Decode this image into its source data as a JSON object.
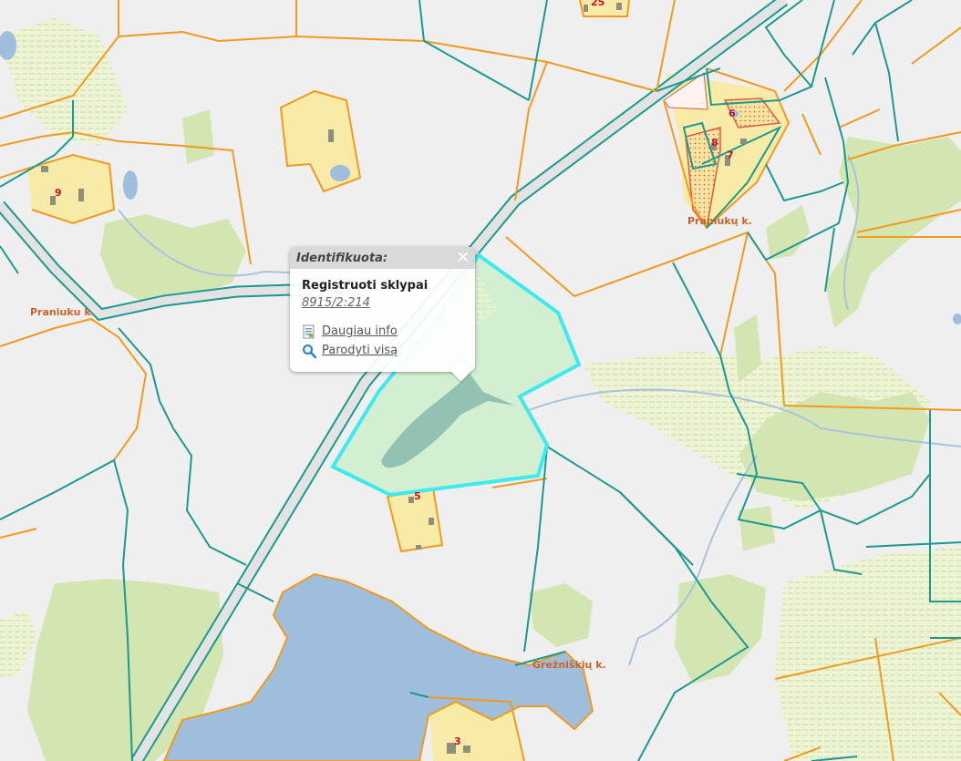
{
  "map": {
    "place_labels": [
      "Praniukų k.",
      "Praniuku k.",
      "Grežniškių k."
    ],
    "plot_numbers": [
      "25",
      "9",
      "6",
      "8",
      "7",
      "5",
      "3"
    ],
    "colors": {
      "background": "#efefef",
      "forest": "#d3e6b2",
      "meadow": "#eef4d4",
      "water": "#9fbedb",
      "settlement": "#f7eba7",
      "parcel_border": "#f19a1e",
      "cadastre_border": "#1b9990",
      "road": "#d6d6d6",
      "selection_fill": "#cdefcd",
      "selection_border": "#3eeaf0",
      "label": "#c8642a",
      "plot_number": "#c4122a"
    }
  },
  "popup": {
    "title": "Identifikuota:",
    "close_symbol": "✕",
    "layer_name": "Registruoti sklypai",
    "parcel_id": "8915/2:214",
    "more_info_label": "Daugiau info",
    "show_all_label": "Parodyti visą",
    "more_info_icon": "document-icon",
    "show_all_icon": "magnifier-icon"
  }
}
